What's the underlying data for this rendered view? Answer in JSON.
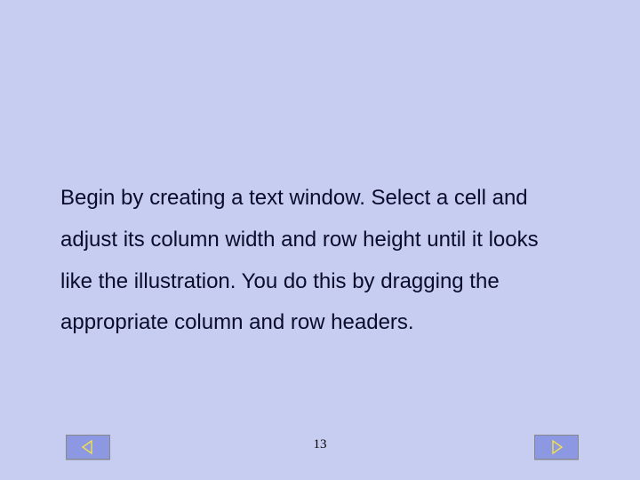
{
  "body_text": "Begin by creating a text window. Select a cell and adjust its column width and row height until it looks like the illustration.  You do this by dragging the appropriate column and row headers.",
  "page_number": "13",
  "colors": {
    "background": "#c7cdf0",
    "button": "#8c98e1",
    "button_arrow": "#f3e14a",
    "text": "#0a0c2c"
  }
}
